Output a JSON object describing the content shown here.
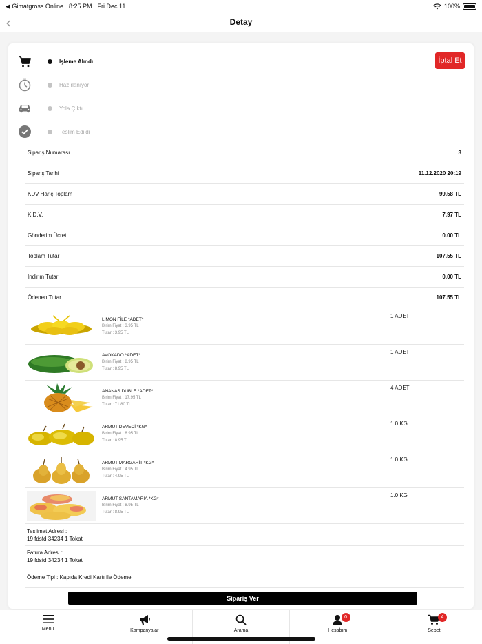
{
  "status": {
    "carrier": "◀ Gimatgross Online",
    "time": "8:25 PM",
    "date": "Fri Dec 11",
    "battery": "100%"
  },
  "nav": {
    "back_glyph": "‹",
    "title": "Detay"
  },
  "steps": [
    {
      "label": "İşleme Alındı",
      "icon": "cart-icon",
      "active": true
    },
    {
      "label": "Hazırlanıyor",
      "icon": "timer-icon",
      "active": false
    },
    {
      "label": "Yola Çıktı",
      "icon": "car-icon",
      "active": false
    },
    {
      "label": "Teslim Edildi",
      "icon": "check-circle-icon",
      "active": false
    }
  ],
  "cancel_label": "İptal Et",
  "summary": [
    {
      "label": "Sipariş Numarası",
      "value": "3"
    },
    {
      "label": "Sipariş Tarihi",
      "value": "11.12.2020 20:19"
    },
    {
      "label": "KDV Hariç Toplam",
      "value": "99.58 TL"
    },
    {
      "label": "K.D.V.",
      "value": "7.97 TL"
    },
    {
      "label": "Gönderim Ücreti",
      "value": "0.00 TL"
    },
    {
      "label": "Toplam Tutar",
      "value": "107.55 TL"
    },
    {
      "label": "İndirim Tutarı",
      "value": "0.00 TL"
    },
    {
      "label": "Ödenen Tutar",
      "value": "107.55 TL"
    }
  ],
  "products": [
    {
      "name": "LİMON FİLE *ADET*",
      "unit_price": "Birim Fiyat : 3.95 TL",
      "total": "Tutar : 3.95 TL",
      "qty": "1  ADET",
      "image": "lemon-image"
    },
    {
      "name": "AVOKADO *ADET*",
      "unit_price": "Birim Fiyat : 8.95 TL",
      "total": "Tutar : 8.95 TL",
      "qty": "1  ADET",
      "image": "avocado-image"
    },
    {
      "name": "ANANAS DUBLE *ADET*",
      "unit_price": "Birim Fiyat : 17.95 TL",
      "total": "Tutar : 71.80 TL",
      "qty": "4  ADET",
      "image": "pineapple-image"
    },
    {
      "name": "ARMUT DEVECİ *KG*",
      "unit_price": "Birim Fiyat : 8.95 TL",
      "total": "Tutar : 8.95 TL",
      "qty": "1.0  KG",
      "image": "pear-deveci-image"
    },
    {
      "name": "ARMUT MARGARİT *KG*",
      "unit_price": "Birim Fiyat : 4.95 TL",
      "total": "Tutar : 4.95 TL",
      "qty": "1.0  KG",
      "image": "pear-margarit-image"
    },
    {
      "name": "ARMUT SANTAMARİA *KG*",
      "unit_price": "Birim Fiyat : 8.95 TL",
      "total": "Tutar : 8.95 TL",
      "qty": "1.0  KG",
      "image": "pear-santamaria-image"
    }
  ],
  "delivery": {
    "delivery_label": "Teslimat Adresi :",
    "delivery_address": "19 fdsfd 34234 1 Tokat",
    "invoice_label": "Fatura Adresi :",
    "invoice_address": "19 fdsfd 34234 1 Tokat",
    "payment": "Ödeme Tipi : Kapıda Kredi Kartı ile Ödeme"
  },
  "order_button": "Sipariş Ver",
  "tabs": [
    {
      "label": "Menü",
      "icon": "menu-icon"
    },
    {
      "label": "Kampanyalar",
      "icon": "megaphone-icon"
    },
    {
      "label": "Arama",
      "icon": "search-icon"
    },
    {
      "label": "Hesabım",
      "icon": "user-icon",
      "badge": "0"
    },
    {
      "label": "Sepet",
      "icon": "basket-icon",
      "badge": "4"
    }
  ],
  "colors": {
    "accent": "#e12727",
    "button": "#000000",
    "inactive": "#aaaaaa"
  }
}
